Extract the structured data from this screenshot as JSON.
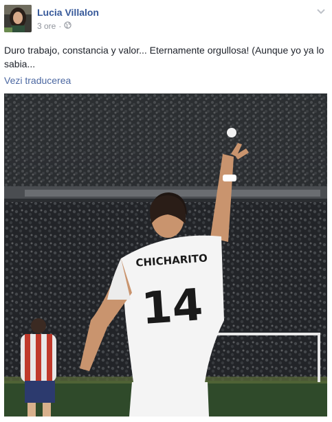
{
  "post": {
    "author_name": "Lucia Villalon",
    "timestamp": "3 ore",
    "separator": "·",
    "audience_icon": "globe-icon",
    "options_icon": "chevron-down-icon",
    "text": "Duro trabajo, constancia y valor... Eternamente orgullosa! (Aunque yo ya lo sabia...",
    "translate_link": "Vezi traducerea"
  },
  "photo": {
    "jersey_name": "CHICHARITO",
    "jersey_number": "14"
  },
  "colors": {
    "link": "#365899",
    "meta": "#90949c",
    "text": "#1d2129"
  }
}
